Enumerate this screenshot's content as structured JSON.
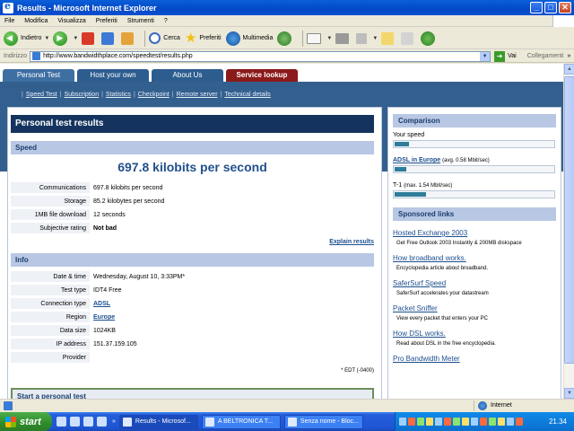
{
  "window": {
    "title": "Results - Microsoft Internet Explorer",
    "min": "_",
    "max": "□",
    "close": "✕"
  },
  "menu": [
    "File",
    "Modifica",
    "Visualizza",
    "Preferiti",
    "Strumenti",
    "?"
  ],
  "toolbar": {
    "back": "Indietro",
    "search": "Cerca",
    "favorites": "Preferiti",
    "media": "Multimedia"
  },
  "address": {
    "label": "Indirizzo",
    "url": "http://www.bandwidthplace.com/speedtest/results.php",
    "go": "Vai",
    "links": "Collegamenti"
  },
  "site": {
    "tabs": [
      "Personal Test",
      "Host your own",
      "About Us",
      "Service lookup"
    ],
    "subnav": [
      "Speed Test",
      "Subscription",
      "Statistics",
      "Checkpoint",
      "Remote server",
      "Technical details"
    ],
    "heading": "Personal test results",
    "speed_section": "Speed",
    "speed_value": "697.8 kilobits per second",
    "speed_rows": [
      {
        "k": "Communications",
        "v": "697.8 kilobits per second"
      },
      {
        "k": "Storage",
        "v": "85.2 kilobytes per second"
      },
      {
        "k": "1MB file download",
        "v": "12 seconds"
      },
      {
        "k": "Subjective rating",
        "v": "Not bad"
      }
    ],
    "explain": "Explain results",
    "info_section": "Info",
    "info_rows": [
      {
        "k": "Date & time",
        "v": "Wednesday, August 10, 3:33PM*"
      },
      {
        "k": "Test type",
        "v": "IDT4 Free"
      },
      {
        "k": "Connection type",
        "v": "ADSL"
      },
      {
        "k": "Region",
        "v": "Europe"
      },
      {
        "k": "Data size",
        "v": "1024KB"
      },
      {
        "k": "IP address",
        "v": "151.37.159.105"
      },
      {
        "k": "Provider",
        "v": ""
      }
    ],
    "tz_note": "* EDT (-0400)",
    "start_box": "Start a personal test",
    "comparison": {
      "title": "Comparison",
      "your_speed": "Your speed",
      "adsl_link": "ADSL in Europe",
      "adsl_note": "(avg. 0.58 Mbit/sec)",
      "t1_label": "T-1",
      "t1_note": "(max. 1.54 Mbit/sec)",
      "your_speed_fraction": 0.09,
      "adsl_fraction": 0.075,
      "t1_fraction": 0.2
    },
    "sponsored": {
      "title": "Sponsored links",
      "ads": [
        {
          "title": "Hosted Exchange 2003",
          "desc": "Get Free Outlook 2003 Instantly & 200MB diskspace"
        },
        {
          "title": "How broadband works.",
          "desc": "Encyclopedia article about broadband."
        },
        {
          "title": "SaferSurf Speed",
          "desc": "SaferSurf accelerates your datastream"
        },
        {
          "title": "Packet Sniffer",
          "desc": "View every packet that enters your PC"
        },
        {
          "title": "How DSL works.",
          "desc": "Read about DSL in the free encyclopedia."
        },
        {
          "title": "Pro Bandwidth Meter",
          "desc": ""
        }
      ]
    }
  },
  "status": {
    "zone": "Internet"
  },
  "taskbar": {
    "start": "start",
    "tasks": [
      "Results - Microsof...",
      "A BELTRONICA T...",
      "Senza nome - Bloc..."
    ],
    "clock": "21.34"
  }
}
